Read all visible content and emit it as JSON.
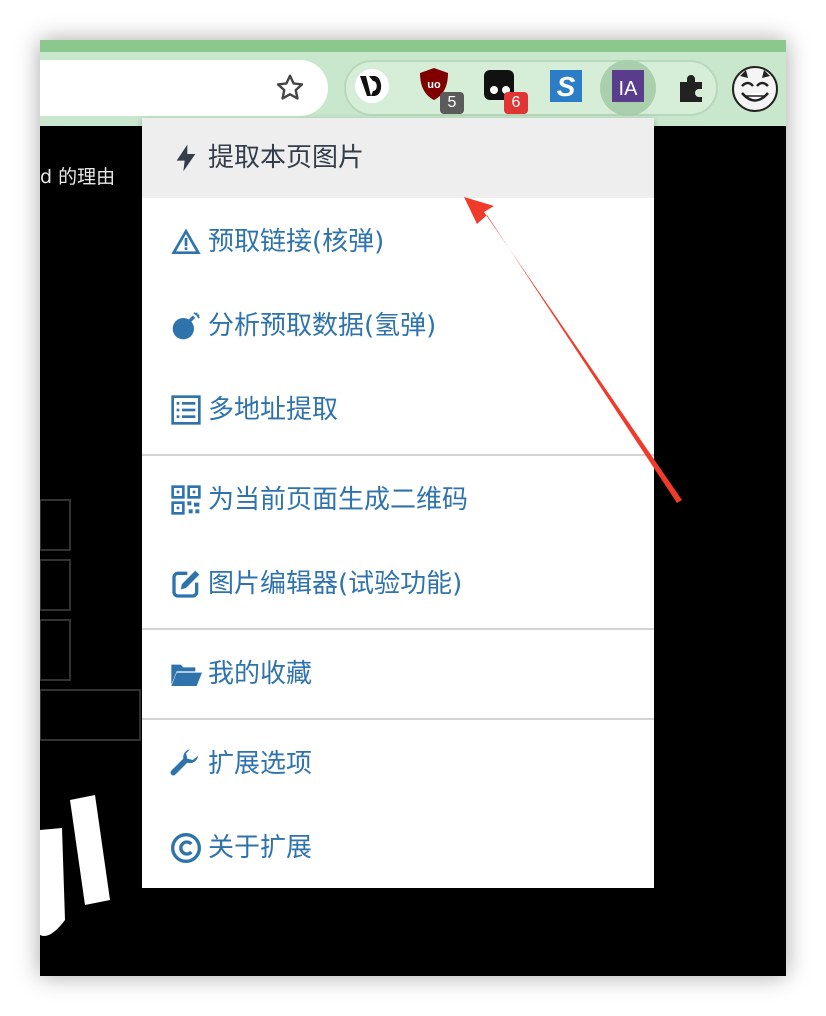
{
  "colors": {
    "accent_green": "#8cc78e",
    "toolbar_bg": "#c8e7cc",
    "menu_text": "#2f73ad",
    "active_bg": "#eeeeee",
    "arrow": "#f03a2a"
  },
  "toolbar": {
    "star_icon": "star-outline",
    "extensions": [
      {
        "name": "vd-extension",
        "badge": ""
      },
      {
        "name": "ublock-origin",
        "badge": "5"
      },
      {
        "name": "tabs-extension",
        "badge": "6"
      },
      {
        "name": "s-extension",
        "badge": ""
      },
      {
        "name": "image-assistant",
        "label": "IA",
        "badge": ""
      },
      {
        "name": "extensions-puzzle",
        "badge": ""
      }
    ]
  },
  "page": {
    "partial_text": "d 的理由"
  },
  "menu": {
    "items": [
      {
        "label": "提取本页图片",
        "icon": "bolt-icon"
      },
      {
        "label": "预取链接(核弹)",
        "icon": "warning-icon"
      },
      {
        "label": "分析预取数据(氢弹)",
        "icon": "bomb-icon"
      },
      {
        "label": "多地址提取",
        "icon": "list-icon"
      },
      {
        "label": "为当前页面生成二维码",
        "icon": "qrcode-icon"
      },
      {
        "label": "图片编辑器(试验功能)",
        "icon": "edit-icon"
      },
      {
        "label": "我的收藏",
        "icon": "folder-open-icon"
      },
      {
        "label": "扩展选项",
        "icon": "wrench-icon"
      },
      {
        "label": "关于扩展",
        "icon": "copyright-icon"
      }
    ]
  }
}
